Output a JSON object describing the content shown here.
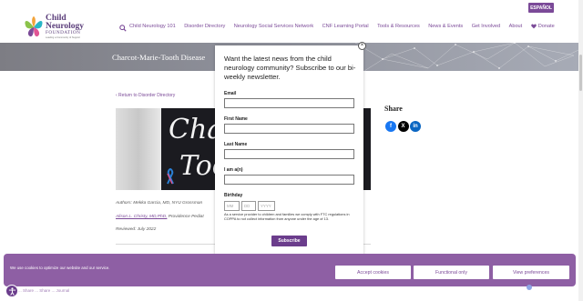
{
  "header": {
    "language_button": "ESPAÑOL",
    "logo": {
      "line1": "Child",
      "line2": "Neurology",
      "line3": "FOUNDATION",
      "tagline": "Leading a Community of Support"
    },
    "nav": [
      "Child Neurology 101",
      "Disorder Directory",
      "Neurology Social Services Network",
      "CNF Learning Portal",
      "Tools & Resources",
      "News & Events",
      "Get Involved",
      "About",
      "Donate"
    ]
  },
  "hero": {
    "title": "Charcot-Marie-Tooth Disease"
  },
  "article": {
    "back_link": "‹ Return to Disorder Directory",
    "image_text_line1": "Char",
    "image_text_line2": "Toot",
    "authors": "Authors: Mekka Garcia, MD, NYU Grossman",
    "authors2_link": "Alison L. Christy, MD,PhD,",
    "authors2_rest": " Providence Pediat",
    "reviewed": "Reviewed: July 2022"
  },
  "share": {
    "title": "Share",
    "icons": [
      "facebook-icon",
      "x-twitter-icon",
      "linkedin-icon"
    ]
  },
  "modal": {
    "heading": "Want the latest news from the child neurology community? Subscribe to our bi-weekly newsletter.",
    "close": "×",
    "fields": [
      {
        "label": "Email",
        "value": ""
      },
      {
        "label": "First Name",
        "value": ""
      },
      {
        "label": "Last Name",
        "value": ""
      },
      {
        "label": "I am a(n)",
        "value": ""
      }
    ],
    "birthday_label": "Birthday",
    "birthday_placeholders": {
      "month": "MM",
      "day": "DD",
      "year": "YYYY"
    },
    "disclaimer": "As a service provider to children and families we comply with FTC regulations in COPPA to not collect information from anyone under the age of 13.",
    "subscribe_label": "Subscribe"
  },
  "cookie_banner": {
    "message": "We use cookies to optimize our website and our service.",
    "accept": "Accept cookies",
    "functional": "Functional only",
    "preferences": "View preferences"
  },
  "bottom_partial": "... Share ... Share ... Journal",
  "colors": {
    "brand_purple": "#7b4a98",
    "cookie_bg": "#8e5fa4",
    "subscribe_bg": "#6b3d8c"
  }
}
